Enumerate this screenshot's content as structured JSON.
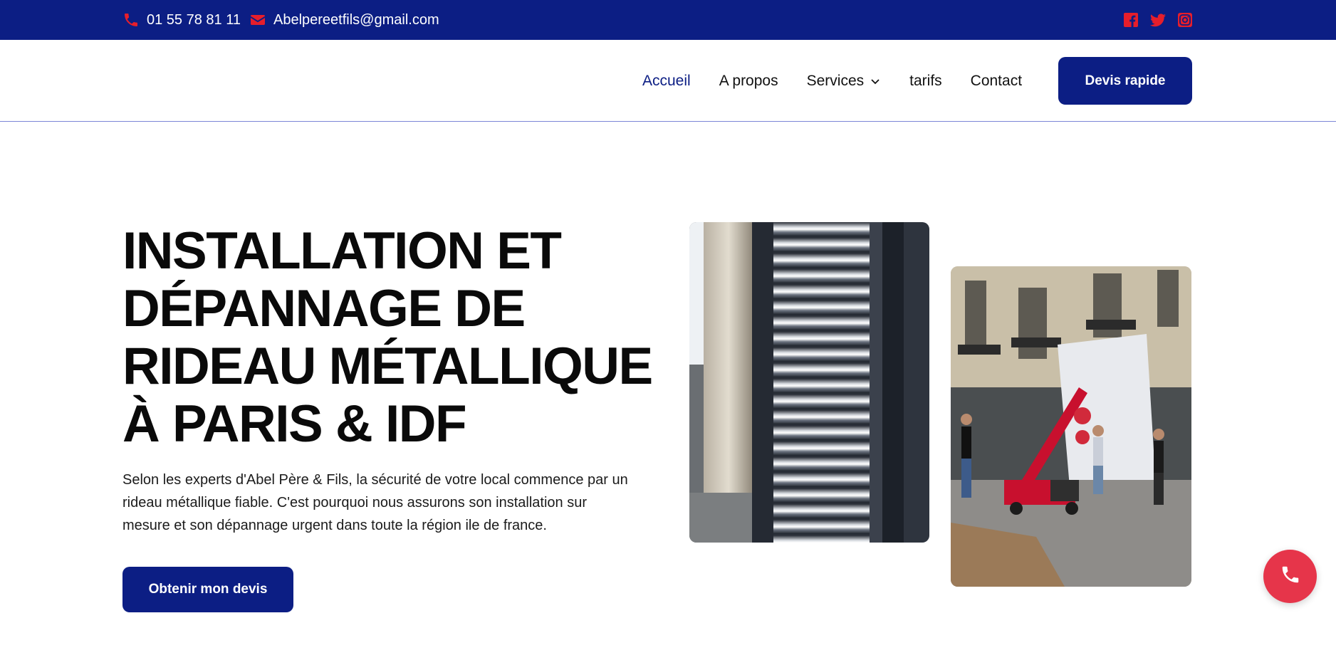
{
  "topbar": {
    "phone": "01 55 78 81 11",
    "email": "Abelpereetfils@gmail.com",
    "social": [
      "facebook-icon",
      "twitter-icon",
      "instagram-icon"
    ],
    "bg_color": "#0c1e84",
    "icon_color": "#e61e2b"
  },
  "nav": {
    "items": [
      {
        "label": "Accueil",
        "active": true
      },
      {
        "label": "A propos"
      },
      {
        "label": "Services",
        "has_dropdown": true
      },
      {
        "label": "tarifs"
      },
      {
        "label": "Contact"
      }
    ],
    "cta": "Devis rapide"
  },
  "hero": {
    "title_lines": [
      "INSTALLATION ET",
      "DÉPANNAGE DE",
      "RIDEAU MÉTALLIQUE",
      "À PARIS & IDF"
    ],
    "description": "Selon les experts d'Abel Père & Fils, la sécurité de votre local commence par un rideau métallique fiable. C'est pourquoi nous assurons son installation sur mesure et son dépannage urgent dans toute la région ile de france.",
    "cta": "Obtenir mon devis"
  },
  "images": {
    "image1": "metal-shutter-photo",
    "image2": "installation-crane-photo"
  },
  "floating": {
    "icon": "phone-icon",
    "color": "#e6354a"
  },
  "brand_color": "#0c1e84"
}
